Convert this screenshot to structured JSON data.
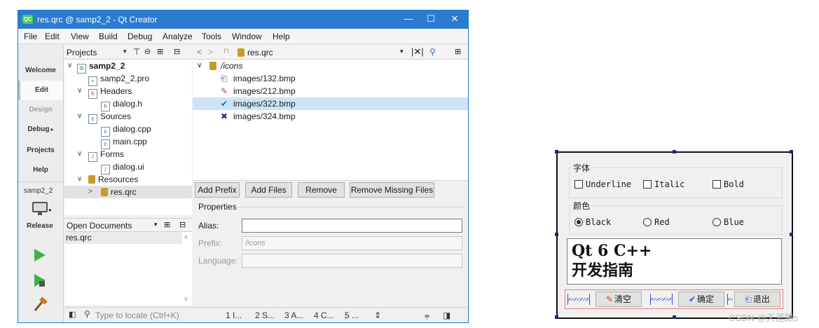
{
  "window": {
    "title": "res.qrc @ samp2_2 - Qt Creator",
    "logo": "QC",
    "min_glyph": "—",
    "max_glyph": "☐",
    "close_glyph": "✕"
  },
  "menu": [
    "File",
    "Edit",
    "View",
    "Build",
    "Debug",
    "Analyze",
    "Tools",
    "Window",
    "Help"
  ],
  "modes": [
    {
      "label": "Welcome",
      "state": "normal"
    },
    {
      "label": "Edit",
      "state": "active"
    },
    {
      "label": "Design",
      "state": "disabled"
    },
    {
      "label": "Debug",
      "state": "normal"
    },
    {
      "label": "Projects",
      "state": "normal"
    },
    {
      "label": "Help",
      "state": "normal"
    }
  ],
  "kit": {
    "project": "samp2_2",
    "config": "Release"
  },
  "projects_pane": {
    "header": "Projects",
    "tree": [
      {
        "label": "samp2_2"
      },
      {
        "label": "samp2_2.pro"
      },
      {
        "label": "Headers"
      },
      {
        "label": "dialog.h"
      },
      {
        "label": "Sources"
      },
      {
        "label": "dialog.cpp"
      },
      {
        "label": "main.cpp"
      },
      {
        "label": "Forms"
      },
      {
        "label": "dialog.ui"
      },
      {
        "label": "Resources"
      },
      {
        "label": "res.qrc"
      }
    ]
  },
  "open_documents": {
    "header": "Open Documents",
    "items": [
      "res.qrc"
    ]
  },
  "editor": {
    "file": "res.qrc",
    "prefix_node": "/icons",
    "resources": [
      {
        "path": "images/132.bmp",
        "icon": "exit-door-icon",
        "selected": false
      },
      {
        "path": "images/212.bmp",
        "icon": "eraser-icon",
        "selected": false
      },
      {
        "path": "images/322.bmp",
        "icon": "checkmark-icon",
        "selected": true
      },
      {
        "path": "images/324.bmp",
        "icon": "cross-icon",
        "selected": false
      }
    ],
    "buttons": [
      "Add Prefix",
      "Add Files",
      "Remove",
      "Remove Missing Files"
    ],
    "properties_title": "Properties",
    "alias_label": "Alias:",
    "alias_value": "",
    "prefix_label": "Prefix:",
    "prefix_value": "/icons",
    "language_label": "Language:",
    "language_value": ""
  },
  "statusbar": {
    "locate_placeholder": "Type to locate (Ctrl+K)",
    "tabs": [
      "1 I...",
      "2 S...",
      "3 A...",
      "4 C...",
      "5 ..."
    ],
    "arrows": "⇕"
  },
  "dialog": {
    "font_group": "字体",
    "underline": "Underline",
    "italic": "Italic",
    "bold": "Bold",
    "color_group": "颜色",
    "black": "Black",
    "red": "Red",
    "blue": "Blue",
    "text": "Qt 6 C++\n开发指南",
    "btn_clear": "清空",
    "btn_ok": "确定",
    "btn_exit": "退出"
  },
  "watermark": "CSDN @天涯路s"
}
